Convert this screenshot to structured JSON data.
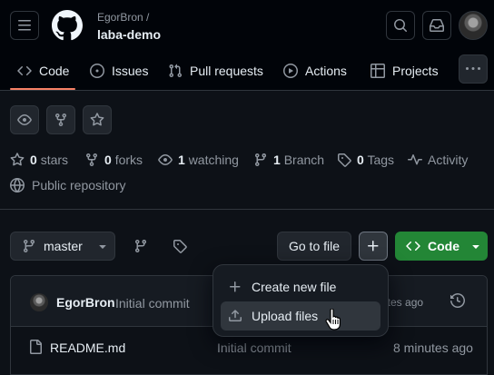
{
  "header": {
    "owner": "EgorBron /",
    "repo": "laba-demo"
  },
  "tabs": [
    {
      "label": "Code",
      "icon": "code-icon",
      "active": true
    },
    {
      "label": "Issues",
      "icon": "issue-icon"
    },
    {
      "label": "Pull requests",
      "icon": "pull-request-icon"
    },
    {
      "label": "Actions",
      "icon": "play-icon"
    },
    {
      "label": "Projects",
      "icon": "table-icon"
    }
  ],
  "stats": {
    "stars_count": "0",
    "stars_label": "stars",
    "forks_count": "0",
    "forks_label": "forks",
    "watching_count": "1",
    "watching_label": "watching",
    "branch_count": "1",
    "branch_label": "Branch",
    "tags_count": "0",
    "tags_label": "Tags",
    "activity_label": "Activity",
    "visibility": "Public repository"
  },
  "toolbar": {
    "branch": "master",
    "go_to_file": "Go to file",
    "code": "Code"
  },
  "commit": {
    "author": "EgorBron",
    "message": "Initial commit",
    "time": "utes ago"
  },
  "files": [
    {
      "name": "README.md",
      "message": "Initial commit",
      "time": "8 minutes ago"
    }
  ],
  "add_menu": {
    "items": [
      {
        "label": "Create new file",
        "icon": "plus-icon"
      },
      {
        "label": "Upload files",
        "icon": "upload-icon",
        "hover": true
      }
    ]
  },
  "colors": {
    "background": "#0d1117",
    "header_background": "#010409",
    "border": "#30363d",
    "accent_underline": "#f78166",
    "primary_button": "#238636",
    "muted_text": "#9198a1"
  }
}
